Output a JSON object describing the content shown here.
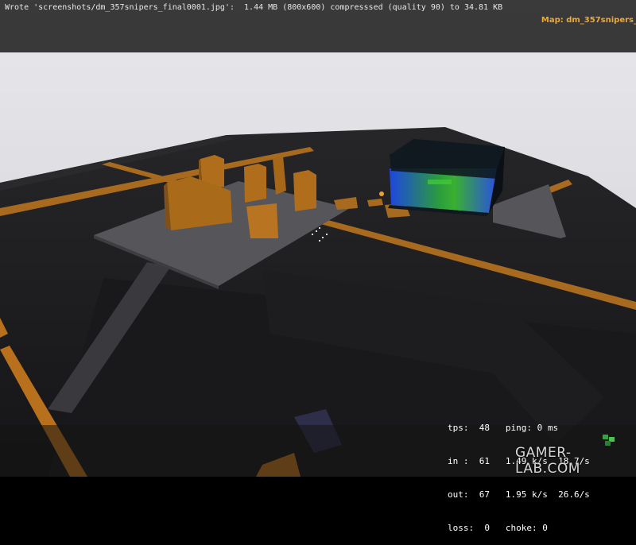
{
  "console": {
    "message": "Wrote 'screenshots/dm_357snipers_final0001.jpg':  1.44 MB (800x600) compresssed (quality 90) to 34.81 KB"
  },
  "map": {
    "label": "Map: dm_357snipers_"
  },
  "netgraph": {
    "rows": [
      "tps:  48   ping: 0 ms",
      "in :  61   1.49 k/s  18.7/s",
      "out:  67   1.95 k/s  26.6/s",
      "loss:  0   choke: 0"
    ]
  },
  "watermark": {
    "text": "GAMER-LAB.COM"
  },
  "colors": {
    "hud_background": "#2a2a2a",
    "map_label": "#f0a830",
    "sky": "#dedee2",
    "ground": "#1c1c1e",
    "orange_brush": "#b8701c",
    "water_blue": "#2a5ad8",
    "water_green": "#2aa830",
    "crosshair": "#dcdcdc"
  },
  "icons": [
    "crosshair-icon",
    "gamer-lab-logo-icon"
  ]
}
